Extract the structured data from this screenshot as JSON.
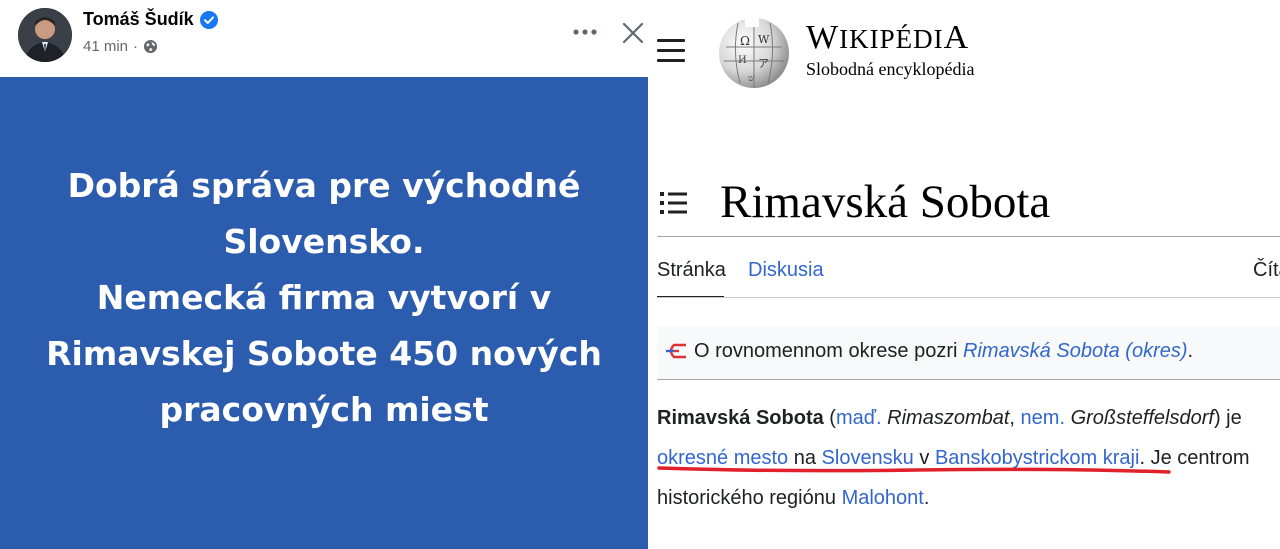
{
  "facebook_post": {
    "author_name": "Tomáš Šudík",
    "timestamp": "41 min",
    "separator": "·",
    "headline_lines": [
      "Dobrá správa pre východné",
      "Slovensko.",
      "Nemecká firma vytvorí v",
      "Rimavskej Sobote 450 nových",
      "pracovných miest"
    ],
    "card_color": "#2c5cad",
    "icons": [
      "verified-badge-icon",
      "globe-icon",
      "more-options-icon",
      "close-icon"
    ]
  },
  "wikipedia": {
    "wordmark": {
      "title_parts": [
        "W",
        "IKIPÉDI",
        "A"
      ],
      "tagline": "Slobodná encyklopédia"
    },
    "page_title": "Rimavská Sobota",
    "tabs": {
      "page": "Stránka",
      "talk": "Diskusia",
      "read": "Číta"
    },
    "hatnote": {
      "prefix": "O rovnomennom okrese pozri ",
      "link": "Rimavská Sobota (okres)",
      "suffix": "."
    },
    "lead": {
      "bold_name": "Rimavská Sobota",
      "paren_open": " (",
      "lang1_link": "maď.",
      "lang1_name": "Rimaszombat",
      "comma": ", ",
      "lang2_link": "nem.",
      "lang2_name": "Großsteffelsdorf",
      "paren_close": ") je",
      "link_okresne": "okresné mesto",
      "word_na": " na ",
      "link_slovensku": "Slovensku",
      "word_v": " v ",
      "link_kraj": "Banskobystrickom kraji",
      "sentence_end": ". Je centrom",
      "line3_prefix": "historického regiónu ",
      "link_malohont": "Malohont",
      "line3_end": "."
    },
    "link_color": "#3366cc",
    "annotation_color": "#e0202a",
    "icons": [
      "menu-icon",
      "wikipedia-globe-logo",
      "table-of-contents-icon",
      "disambiguation-icon"
    ]
  }
}
